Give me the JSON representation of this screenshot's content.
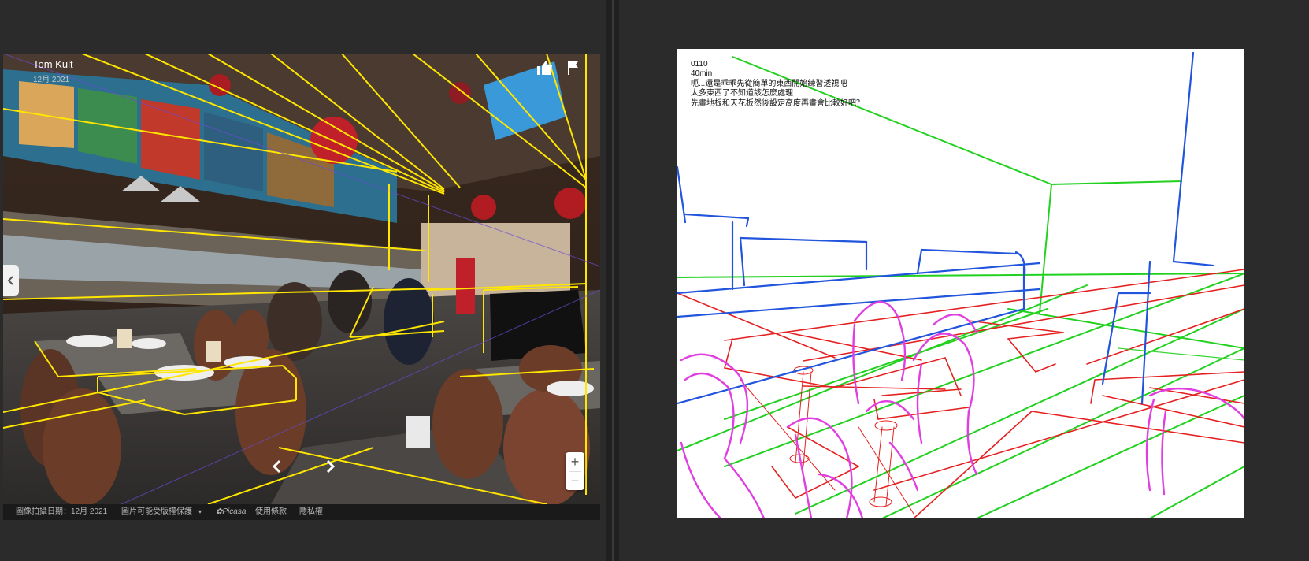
{
  "viewer": {
    "author": "Tom Kult",
    "date": "12月 2021",
    "footer": {
      "capture_date": "圖像拍攝日期：12月 2021",
      "copyright": "圖片可能受版權保護",
      "brand": "Picasa",
      "terms": "使用條款",
      "privacy": "隱私權"
    },
    "icons": {
      "like": "thumbs-up-icon",
      "report": "flag-icon",
      "previous": "chevron-left-icon",
      "next": "chevron-right-icon",
      "collapse": "chevron-left-icon"
    },
    "zoom": {
      "in_label": "+",
      "out_label": "−"
    }
  },
  "canvas": {
    "notes": [
      "0110",
      "40min",
      "呃...還是乖乖先從簡單的東西開始練習透視吧",
      "太多東西了不知道該怎麼處理",
      "先畫地板和天花板然後設定高度再畫會比較好吧？"
    ]
  },
  "colors": {
    "background": "#2b2b2b",
    "overlay_lines": "#ffe600",
    "sketch_red": "#e52020",
    "sketch_green": "#22d11f",
    "sketch_blue": "#2255dd",
    "sketch_magenta": "#e03ee0"
  }
}
